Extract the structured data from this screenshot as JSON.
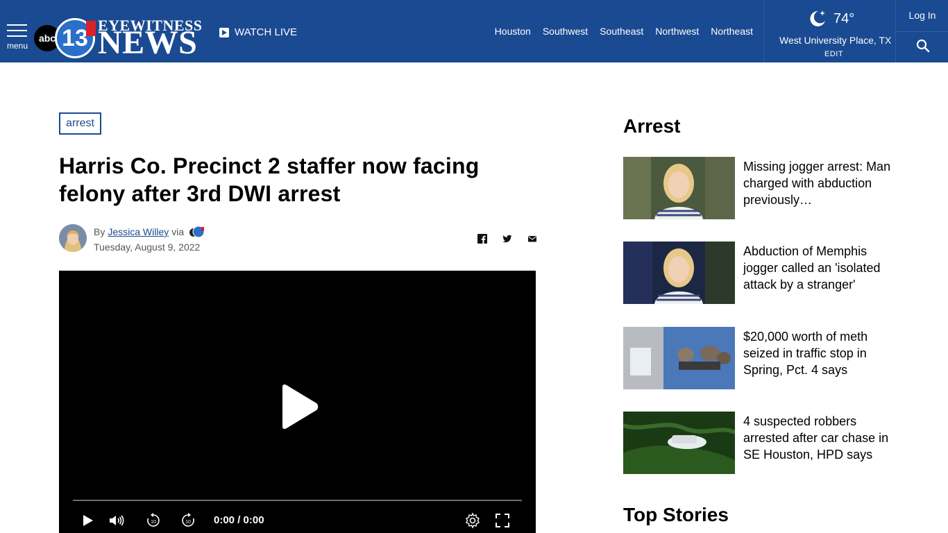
{
  "header": {
    "menu_label": "menu",
    "logo": {
      "abc": "abc",
      "number": "13",
      "eyewitness": "EYEWITNESS",
      "news": "NEWS"
    },
    "watch_live": "WATCH LIVE",
    "nav": [
      "Houston",
      "Southwest",
      "Southeast",
      "Northwest",
      "Northeast"
    ],
    "weather": {
      "icon": "moon-stars-icon",
      "temp": "74°",
      "location": "West University Place, TX",
      "edit": "EDIT"
    },
    "login": "Log In",
    "search_icon": "search-icon",
    "colors": {
      "bar": "#1a4a91",
      "accent_blue": "#2a6fc9",
      "accent_red": "#d8232a"
    }
  },
  "article": {
    "tag": "arrest",
    "headline": "Harris Co. Precinct 2 staffer now facing felony after 3rd DWI arrest",
    "byline": {
      "by": "By",
      "author": "Jessica Willey",
      "via": "via"
    },
    "date": "Tuesday, August 9, 2022",
    "share": [
      "facebook-icon",
      "twitter-icon",
      "email-icon"
    ],
    "video": {
      "time": "0:00 / 0:00",
      "progress": 0
    }
  },
  "sidebar": {
    "section_title": "Arrest",
    "stories": [
      {
        "title": "Missing jogger arrest: Man charged with abduction previously…"
      },
      {
        "title": "Abduction of Memphis jogger called an 'isolated attack by a stranger'"
      },
      {
        "title": "$20,000 worth of meth seized in traffic stop in Spring, Pct. 4 says"
      },
      {
        "title": "4 suspected robbers arrested after car chase in SE Houston, HPD says"
      }
    ],
    "top_stories_title": "Top Stories"
  }
}
